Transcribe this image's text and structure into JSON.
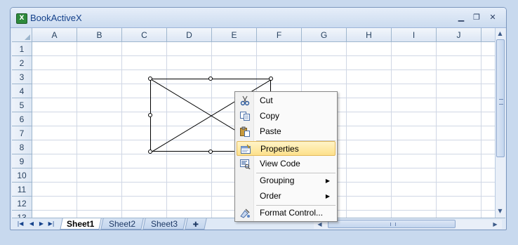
{
  "window": {
    "title": "BookActiveX",
    "minimize_icon": "minimize-icon",
    "restore_icon": "restore-icon",
    "close_icon": "close-icon"
  },
  "columns": [
    "A",
    "B",
    "C",
    "D",
    "E",
    "F",
    "G",
    "H",
    "I",
    "J"
  ],
  "rows": [
    "1",
    "2",
    "3",
    "4",
    "5",
    "6",
    "7",
    "8",
    "9",
    "10",
    "11",
    "12",
    "13"
  ],
  "sheets": {
    "tabs": [
      "Sheet1",
      "Sheet2",
      "Sheet3"
    ],
    "active": "Sheet1"
  },
  "context_menu": {
    "items": [
      {
        "label": "Cut",
        "icon": "scissors-icon"
      },
      {
        "label": "Copy",
        "icon": "copy-icon"
      },
      {
        "label": "Paste",
        "icon": "paste-icon"
      },
      {
        "label": "Properties",
        "icon": "properties-icon",
        "highlighted": true
      },
      {
        "label": "View Code",
        "icon": "view-code-icon"
      },
      {
        "label": "Grouping",
        "submenu": true
      },
      {
        "label": "Order",
        "submenu": true
      },
      {
        "label": "Format Control...",
        "icon": "format-control-icon"
      }
    ]
  },
  "colors": {
    "highlight": "#fde08a",
    "header": "#dce6f4",
    "gridline": "#d0d7e5"
  }
}
